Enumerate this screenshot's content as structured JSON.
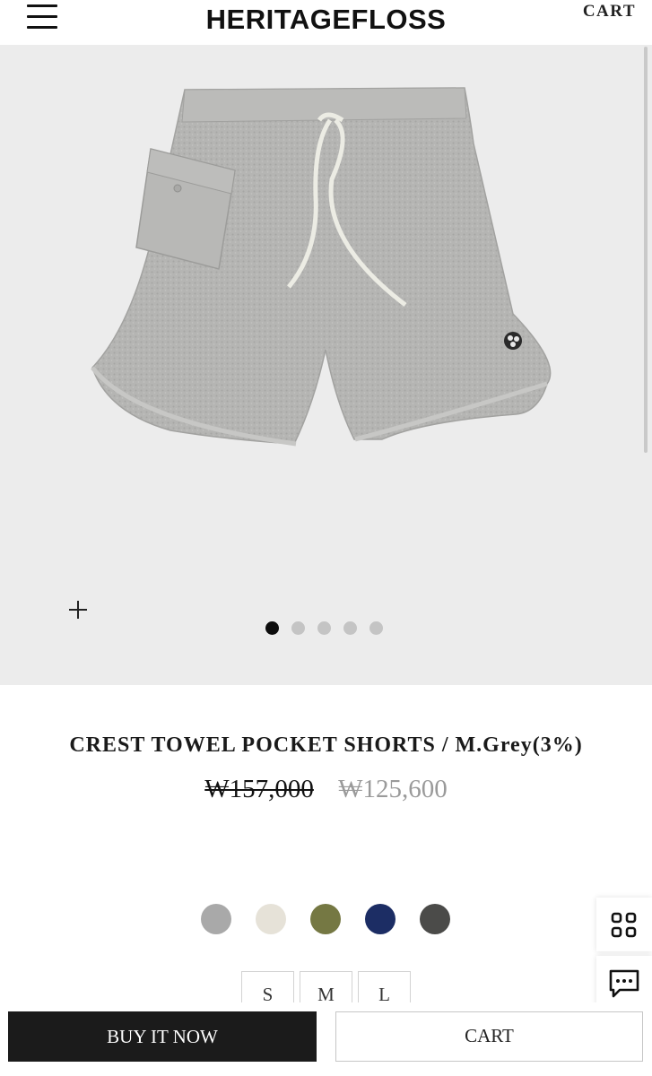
{
  "header": {
    "logo": "HERITAGEFLOSS",
    "cart_label": "CART"
  },
  "gallery": {
    "slide_count": 5,
    "active_slide": 1
  },
  "product": {
    "title": "CREST TOWEL POCKET SHORTS / M.Grey(3%)",
    "original_price": "₩157,000",
    "sale_price": "₩125,600"
  },
  "colors": [
    "#a9a9a9",
    "#e6e2d8",
    "#757843",
    "#1c2d64",
    "#4b4b49"
  ],
  "sizes": [
    "S",
    "M",
    "L"
  ],
  "actions": {
    "buy_now_label": "BUY IT NOW",
    "cart_label": "CART"
  },
  "icons": {
    "menu": "hamburger-menu-icon",
    "zoom": "plus-icon",
    "grid": "grid-icon",
    "chat": "chat-bubble-icon"
  }
}
